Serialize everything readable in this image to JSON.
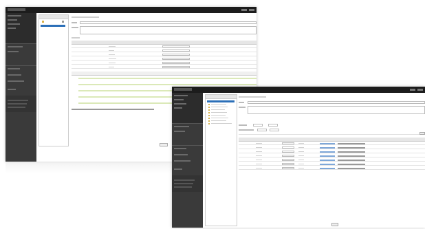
{
  "screens": [
    {
      "window": {
        "title": "",
        "brand": ""
      },
      "sidebar": {
        "items": [
          "",
          "",
          "",
          "",
          "",
          "",
          "",
          ""
        ]
      },
      "tree_panel": {
        "items": [
          ""
        ]
      },
      "form": {
        "title": "",
        "name_label": "",
        "name_value": "",
        "desc_label": ""
      },
      "table": {
        "columns": [
          "",
          ""
        ],
        "rows": 6
      },
      "timeline": {
        "rows": 6
      },
      "legend": {
        "items": []
      },
      "footer_button": ""
    },
    {
      "window": {
        "title": "",
        "brand": ""
      },
      "sidebar": {
        "items": [
          "",
          "",
          "",
          "",
          "",
          "",
          "",
          ""
        ]
      },
      "tree_panel": {
        "items": [
          "",
          "",
          "",
          "",
          "",
          "",
          "",
          ""
        ]
      },
      "form": {
        "title": "",
        "name_label": "",
        "name_value": "",
        "desc_label": ""
      },
      "filters": {
        "label1": "",
        "value1": "",
        "label2": "",
        "value2": ""
      },
      "table": {
        "columns": [
          "",
          "",
          "",
          ""
        ],
        "rows": 9
      },
      "footer_button": ""
    }
  ],
  "colors": {
    "topbar": "#1c1c1c",
    "sidebar": "#3a3a3a",
    "selection": "#2b6fb8",
    "highlight": "#dbe9b8"
  }
}
